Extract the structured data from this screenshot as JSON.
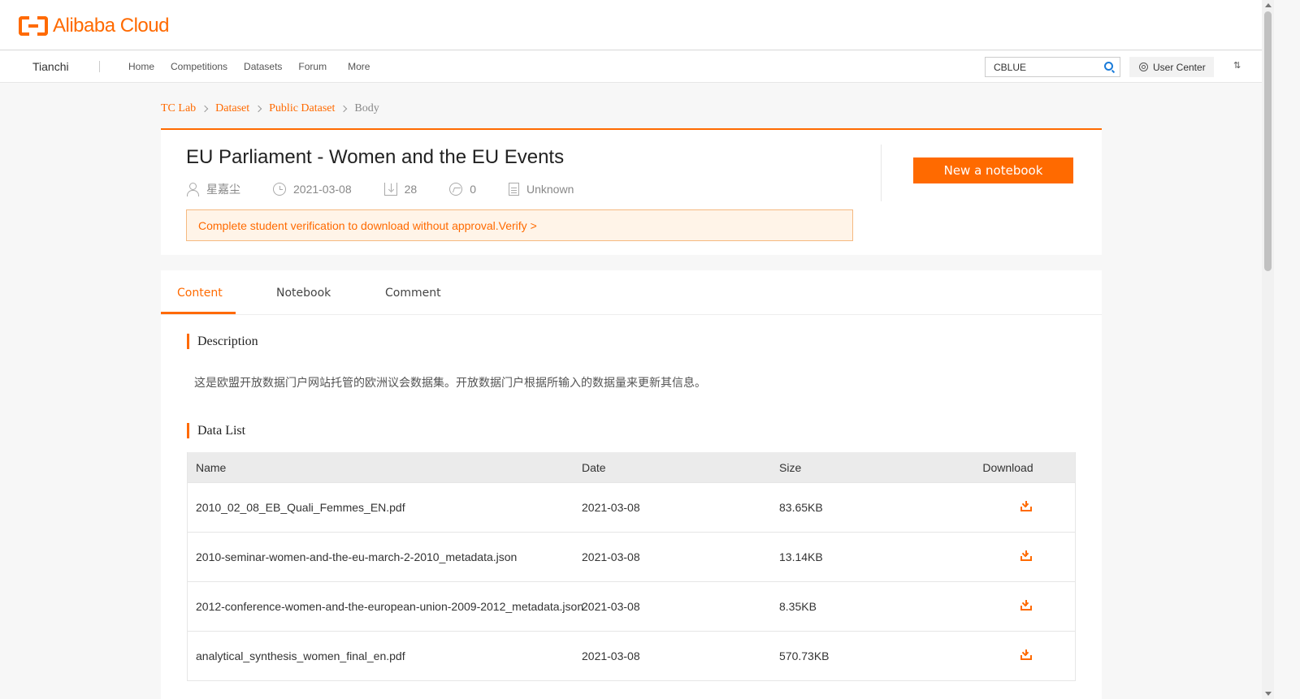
{
  "brand": {
    "logo_text": "Alibaba Cloud",
    "accent": "#ff6a00"
  },
  "nav": {
    "brand": "Tianchi",
    "links": [
      "Home",
      "Competitions",
      "Datasets",
      "Forum",
      "More"
    ],
    "search_value": "CBLUE",
    "user_center": "User Center"
  },
  "breadcrumb": [
    "TC Lab",
    "Dataset",
    "Public Dataset",
    "Body"
  ],
  "dataset": {
    "title": "EU Parliament - Women and the EU Events",
    "author": "星嘉尘",
    "date": "2021-03-08",
    "downloads": "28",
    "shares": "0",
    "license": "Unknown",
    "verify_banner": " Complete student verification to download without approval.Verify >",
    "new_notebook": "New a notebook"
  },
  "tabs": [
    "Content",
    "Notebook",
    "Comment"
  ],
  "description": {
    "heading": "Description",
    "text": "这是欧盟开放数据门户网站托管的欧洲议会数据集。开放数据门户根据所输入的数据量来更新其信息。"
  },
  "data_list": {
    "heading": "Data List",
    "columns": [
      "Name",
      "Date",
      "Size",
      "Download"
    ],
    "rows": [
      {
        "name": "2010_02_08_EB_Quali_Femmes_EN.pdf",
        "date": "2021-03-08",
        "size": "83.65KB"
      },
      {
        "name": "2010-seminar-women-and-the-eu-march-2-2010_metadata.json",
        "date": "2021-03-08",
        "size": "13.14KB"
      },
      {
        "name": "2012-conference-women-and-the-european-union-2009-2012_metadata.json",
        "date": "2021-03-08",
        "size": "8.35KB"
      },
      {
        "name": "analytical_synthesis_women_final_en.pdf",
        "date": "2021-03-08",
        "size": "570.73KB"
      }
    ]
  }
}
